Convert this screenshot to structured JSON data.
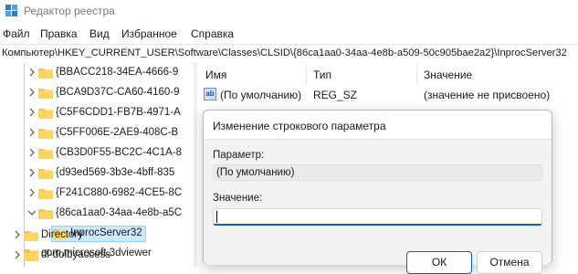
{
  "window": {
    "title": "Редактор реестра"
  },
  "menu": [
    "Файл",
    "Правка",
    "Вид",
    "Избранное",
    "Справка"
  ],
  "address": "Компьютер\\HKEY_CURRENT_USER\\Software\\Classes\\CLSID\\{86ca1aa0-34aa-4e8b-a509-50c905bae2a2}\\InprocServer32",
  "tree": {
    "items": [
      {
        "label": "{BBACC218-34EA-4666-9",
        "expanded": false
      },
      {
        "label": "{BCA9D37C-CA60-4160-9",
        "expanded": false
      },
      {
        "label": "{C5F6CDD1-FB7B-4971-A",
        "expanded": false
      },
      {
        "label": "{C5FF006E-2AE9-408C-B",
        "expanded": false
      },
      {
        "label": "{CB3D0F55-BC2C-4C1A-8",
        "expanded": false
      },
      {
        "label": "{d93ed569-3b3e-4bff-835",
        "expanded": false
      },
      {
        "label": "{F241C880-6982-4CE5-8C",
        "expanded": false
      },
      {
        "label": "{86ca1aa0-34aa-4e8b-a5C",
        "expanded": true
      },
      {
        "label": "InprocServer32",
        "selected": true
      },
      {
        "label": "com.microsoft.3dviewer"
      },
      {
        "label": "Directory"
      },
      {
        "label": "dl-dolbyaccess"
      }
    ]
  },
  "list": {
    "columns": [
      "Имя",
      "Тип",
      "Значение"
    ],
    "rows": [
      {
        "icon": "string-value-icon",
        "name": "(По умолчанию)",
        "type": "REG_SZ",
        "value": "(значение не присвоено)"
      }
    ]
  },
  "dialog": {
    "title": "Изменение строкового параметра",
    "param_label": "Параметр:",
    "param_value": "(По умолчанию)",
    "value_label": "Значение:",
    "value_input": "",
    "ok_label": "ОК",
    "cancel_label": "Отмена"
  },
  "colors": {
    "accent": "#0067c0",
    "selection": "#cce8ff",
    "folder": "#f5c443"
  }
}
